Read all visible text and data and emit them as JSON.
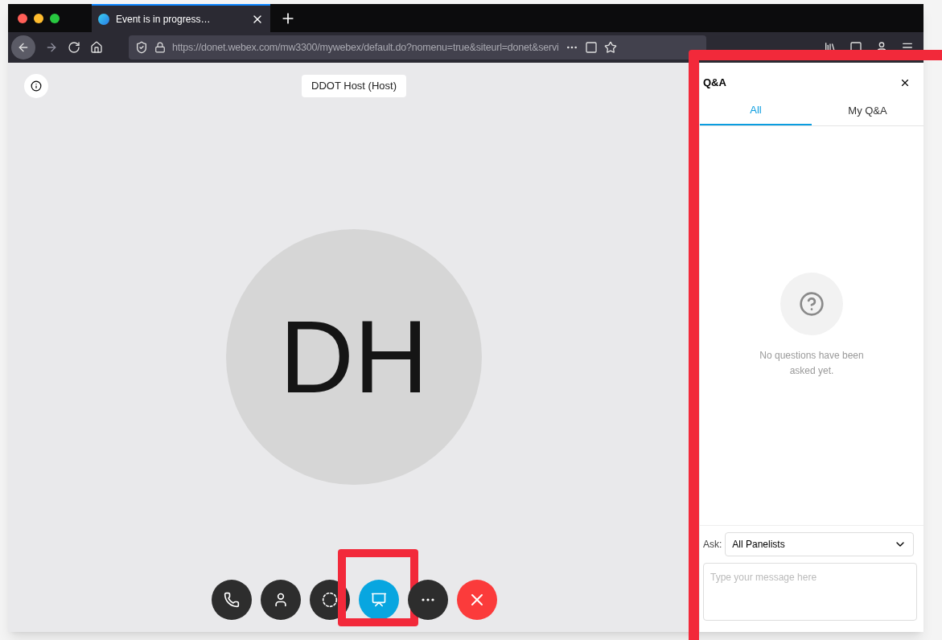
{
  "browser": {
    "tab_title": "Event is in progress…",
    "url": "https://donet.webex.com/mw3300/mywebex/default.do?nomenu=true&siteurl=donet&servi"
  },
  "meeting": {
    "host_label": "DDOT Host (Host)",
    "avatar_initials": "DH"
  },
  "controls": [
    {
      "kind": "phone",
      "selected": false,
      "highlighted": false
    },
    {
      "kind": "person",
      "selected": false,
      "highlighted": false
    },
    {
      "kind": "ring",
      "selected": false,
      "highlighted": false
    },
    {
      "kind": "share",
      "selected": true,
      "highlighted": true
    },
    {
      "kind": "more",
      "selected": false,
      "highlighted": false
    },
    {
      "kind": "end",
      "selected": false,
      "highlighted": false
    }
  ],
  "qa_panel": {
    "title": "Q&A",
    "highlighted": true,
    "tabs": [
      {
        "label": "All",
        "selected": true
      },
      {
        "label": "My Q&A",
        "selected": false
      }
    ],
    "empty_message": "No questions have been asked yet.",
    "ask_label": "Ask:",
    "ask_value": "All Panelists",
    "message_placeholder": "Type your message here"
  }
}
